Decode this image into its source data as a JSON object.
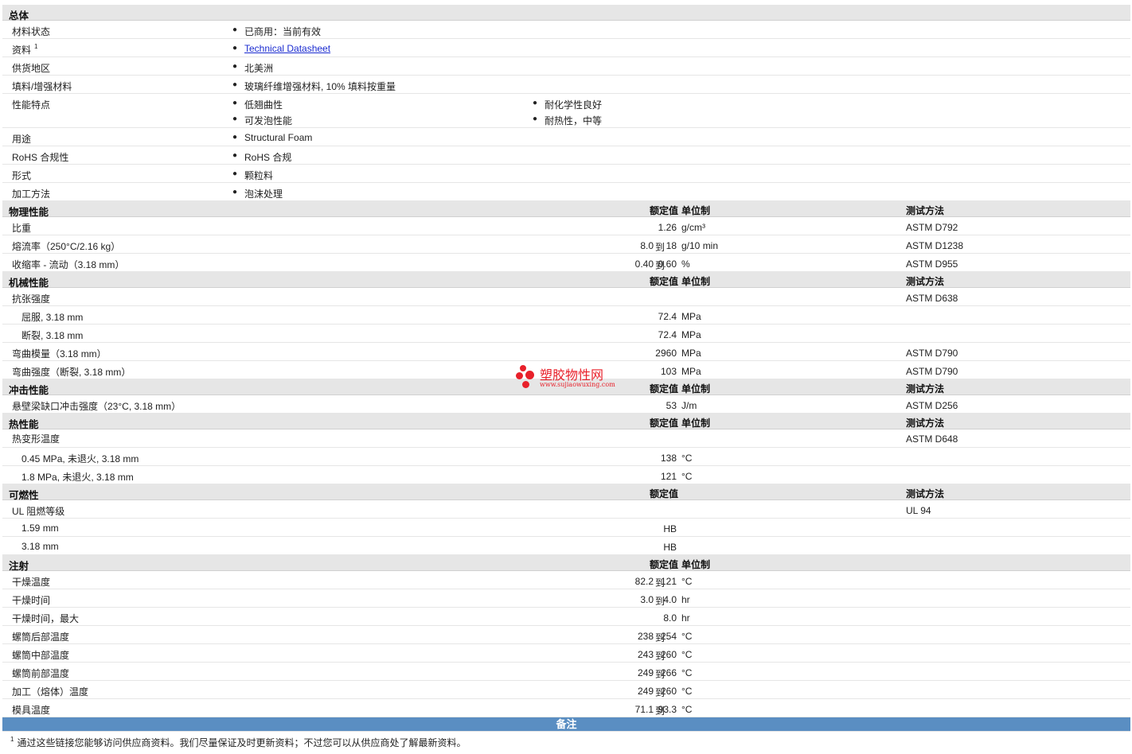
{
  "sections": {
    "general": "总体",
    "physical": "物理性能",
    "mechanical": "机械性能",
    "impact": "冲击性能",
    "thermal": "热性能",
    "flammability": "可燃性",
    "injection": "注射"
  },
  "headers": {
    "nominal": "额定值",
    "unit": "单位制",
    "test_method": "测试方法"
  },
  "general": {
    "material_status": {
      "label": "材料状态",
      "value": "已商用：当前有效"
    },
    "literature": {
      "label": "资料",
      "sup": "1",
      "link": "Technical Datasheet"
    },
    "availability": {
      "label": "供货地区",
      "value": "北美洲"
    },
    "filler": {
      "label": "填料/增强材料",
      "value": "玻璃纤维增强材料, 10% 填料按重量"
    },
    "features": {
      "label": "性能特点",
      "values": [
        "低翘曲性",
        "可发泡性能",
        "耐化学性良好",
        "耐热性，中等"
      ]
    },
    "uses": {
      "label": "用途",
      "value": "Structural Foam"
    },
    "rohs": {
      "label": "RoHS 合规性",
      "value": "RoHS 合规"
    },
    "form": {
      "label": "形式",
      "value": "颗粒料"
    },
    "processing": {
      "label": "加工方法",
      "value": "泡沫处理"
    }
  },
  "physical": [
    {
      "label": "比重",
      "low": "",
      "high": "1.26",
      "unit": "g/cm³",
      "method": "ASTM D792"
    },
    {
      "label": "熔流率（250°C/2.16 kg）",
      "low": "8.0",
      "high": "18",
      "unit": "g/10 min",
      "method": "ASTM D1238"
    },
    {
      "label": "收缩率 - 流动（3.18 mm）",
      "low": "0.40",
      "high": "0.60",
      "unit": "%",
      "method": "ASTM D955"
    }
  ],
  "mechanical": {
    "tensile": {
      "label": "抗张强度",
      "method": "ASTM D638"
    },
    "yield": {
      "label": "屈服, 3.18 mm",
      "value": "72.4",
      "unit": "MPa"
    },
    "break": {
      "label": "断裂, 3.18 mm",
      "value": "72.4",
      "unit": "MPa"
    },
    "flex_mod": {
      "label": "弯曲模量（3.18 mm）",
      "value": "2960",
      "unit": "MPa",
      "method": "ASTM D790"
    },
    "flex_str": {
      "label": "弯曲强度（断裂, 3.18 mm）",
      "value": "103",
      "unit": "MPa",
      "method": "ASTM D790"
    }
  },
  "impact": {
    "izod": {
      "label": "悬壁梁缺口冲击强度（23°C, 3.18 mm）",
      "value": "53",
      "unit": "J/m",
      "method": "ASTM D256"
    }
  },
  "thermal": {
    "hdt": {
      "label": "热变形温度",
      "method": "ASTM D648"
    },
    "hdt1": {
      "label": "0.45 MPa, 未退火, 3.18 mm",
      "value": "138",
      "unit": "°C"
    },
    "hdt2": {
      "label": "1.8 MPa, 未退火, 3.18 mm",
      "value": "121",
      "unit": "°C"
    }
  },
  "flammability": {
    "ul": {
      "label": "UL 阻燃等级",
      "method": "UL 94"
    },
    "t1": {
      "label": "1.59 mm",
      "value": "HB"
    },
    "t2": {
      "label": "3.18 mm",
      "value": "HB"
    }
  },
  "injection": [
    {
      "label": "干燥温度",
      "low": "82.2",
      "high": "121",
      "unit": "°C"
    },
    {
      "label": "干燥时间",
      "low": "3.0",
      "high": "4.0",
      "unit": "hr"
    },
    {
      "label": "干燥时间，最大",
      "low": "",
      "high": "8.0",
      "unit": "hr"
    },
    {
      "label": "螺筒后部温度",
      "low": "238",
      "high": "254",
      "unit": "°C"
    },
    {
      "label": "螺筒中部温度",
      "low": "243",
      "high": "260",
      "unit": "°C"
    },
    {
      "label": "螺筒前部温度",
      "low": "249",
      "high": "266",
      "unit": "°C"
    },
    {
      "label": "加工（熔体）温度",
      "low": "249",
      "high": "260",
      "unit": "°C"
    },
    {
      "label": "模具温度",
      "low": "71.1",
      "high": "93.3",
      "unit": "°C"
    }
  ],
  "range_word": "到",
  "bullet": "●",
  "notes": {
    "title": "备注",
    "sup": "1",
    "text": "通过这些链接您能够访问供应商资料。我们尽量保证及时更新资料；不过您可以从供应商处了解最新资料。"
  },
  "watermark": {
    "name": "塑胶物性网",
    "url": "www.sujiaowuxing.com"
  },
  "colors": {
    "section_bg": "#e6e6e6",
    "notes_bar": "#5a8ec2",
    "link": "#1a2bd0",
    "watermark": "#e8202a"
  }
}
